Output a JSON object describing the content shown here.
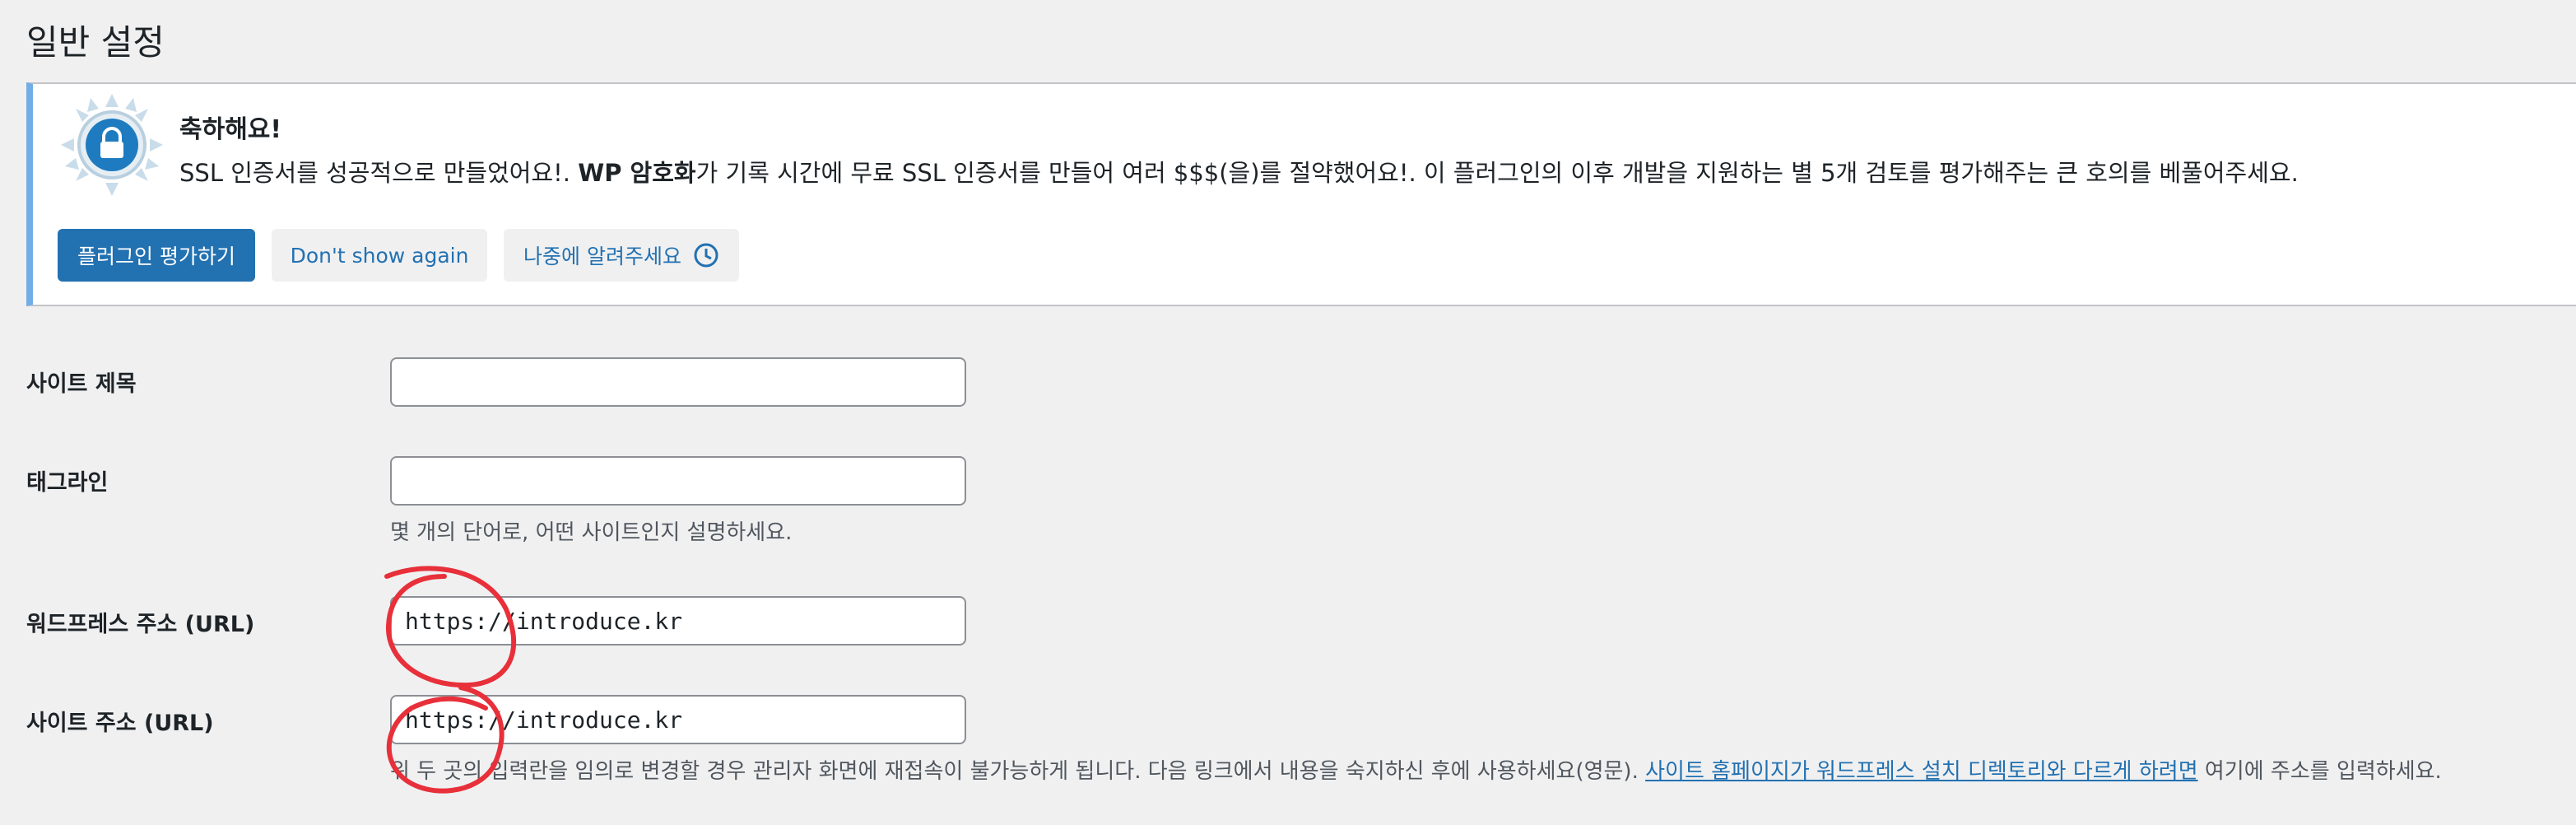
{
  "page": {
    "title": "일반 설정"
  },
  "notice": {
    "title": "축하해요!",
    "message_part1": "SSL 인증서를 성공적으로 만들었어요!. ",
    "message_bold": "WP 암호화",
    "message_part2": "가 기록 시간에 무료 SSL 인증서를 만들어 여러 $$$(을)를 절약했어요!. 이 플러그인의 이후 개발을 지원하는 별 5개 검토를 평가해주는 큰 호의를 베풀어주세요.",
    "rate_button": "플러그인 평가하기",
    "dismiss_button": "Don't show again",
    "remind_button": "나중에 알려주세요",
    "logo_icon": "lock-icon",
    "accent_color": "#72aee6"
  },
  "form": {
    "site_title": {
      "label": "사이트 제목",
      "value": ""
    },
    "tagline": {
      "label": "태그라인",
      "value": "",
      "description": "몇 개의 단어로, 어떤 사이트인지 설명하세요."
    },
    "wp_address": {
      "label": "워드프레스 주소 (URL)",
      "value": "https://introduce.kr"
    },
    "site_address": {
      "label": "사이트 주소 (URL)",
      "value": "https://introduce.kr",
      "description_part1": "위 두 곳의 입력란을 임의로 변경할 경우 관리자 화면에 재접속이 불가능하게 됩니다. 다음 링크에서 내용을 숙지하신 후에 사용하세요(영문). ",
      "description_link": "사이트 홈페이지가 워드프레스 설치 디렉토리와 다르게 하려면",
      "description_part2": " 여기에 주소를 입력하세요."
    }
  },
  "colors": {
    "primary": "#2271b1",
    "annotation": "#e8303a"
  }
}
